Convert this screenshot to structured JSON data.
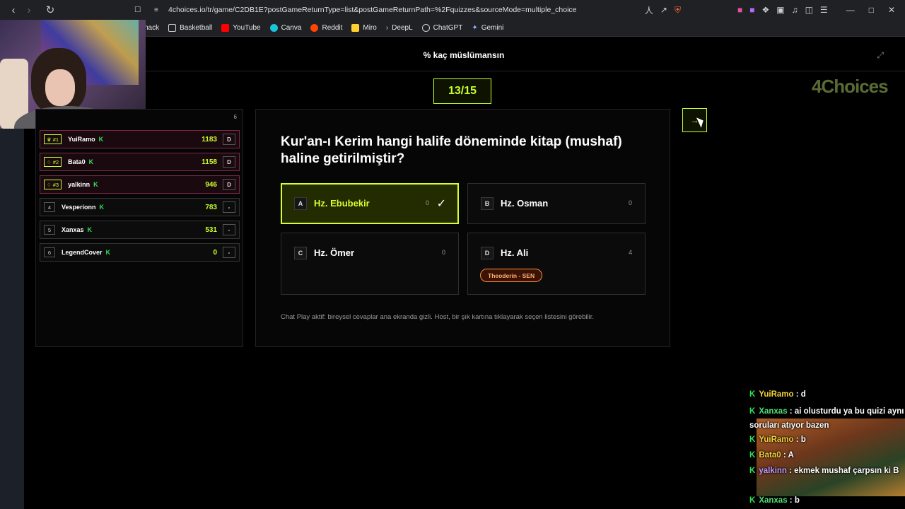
{
  "browser": {
    "url": "4choices.io/tr/game/C2DB1E?postGameReturnType=list&postGameReturnPath=%2Fquizzes&sourceMode=multiple_choice",
    "bookmarks": [
      "nack",
      "Basketball",
      "YouTube",
      "Canva",
      "Reddit",
      "Miro",
      "DeepL",
      "ChatGPT",
      "Gemini"
    ]
  },
  "header": {
    "title": "% kaç müslümansın"
  },
  "progress": {
    "label": "13/15"
  },
  "logo": "4Choices",
  "leaderboard": {
    "count": "6",
    "players": [
      {
        "rank": "#1",
        "name": "YuiRamo",
        "badge": "K",
        "score": "1183",
        "status": "D"
      },
      {
        "rank": "#2",
        "name": "Bata0",
        "badge": "K",
        "score": "1158",
        "status": "D"
      },
      {
        "rank": "#3",
        "name": "yalkinn",
        "badge": "K",
        "score": "946",
        "status": "D"
      },
      {
        "rank": "4",
        "name": "Vesperionn",
        "badge": "K",
        "score": "783",
        "status": "-"
      },
      {
        "rank": "5",
        "name": "Xanxas",
        "badge": "K",
        "score": "531",
        "status": "-"
      },
      {
        "rank": "6",
        "name": "LegendCover",
        "badge": "K",
        "score": "0",
        "status": "-"
      }
    ]
  },
  "question": {
    "text": "Kur'an-ı Kerim hangi halife döneminde kitap (mushaf) haline getirilmiştir?",
    "options": [
      {
        "letter": "A",
        "label": "Hz. Ebubekir",
        "count": "0",
        "correct": true
      },
      {
        "letter": "B",
        "label": "Hz. Osman",
        "count": "0"
      },
      {
        "letter": "C",
        "label": "Hz. Ömer",
        "count": "0"
      },
      {
        "letter": "D",
        "label": "Hz. Ali",
        "count": "4",
        "tag": "Theoderin - SEN"
      }
    ],
    "note": "Chat Play aktif: bireysel cevaplar ana ekranda gizli. Host, bir şık kartına tıklayarak seçen listesini görebilir."
  },
  "next_button": {
    "label": "→"
  },
  "chat": [
    {
      "user": "YuiRamo",
      "message": ": d",
      "color": "yellow"
    },
    {
      "user": "Xanxas",
      "message": ": ai olusturdu ya bu quizi aynı soruları atıyor bazen",
      "color": "green"
    },
    {
      "user": "YuiRamo",
      "message": ": b",
      "color": "yellow"
    },
    {
      "user": "Bata0",
      "message": ": A",
      "color": "yellow"
    },
    {
      "user": "yalkinn",
      "message": ": ekmek mushaf çarpsın ki B",
      "color": "purple"
    },
    {
      "user": "Xanxas",
      "message": ": b",
      "color": "green"
    }
  ]
}
